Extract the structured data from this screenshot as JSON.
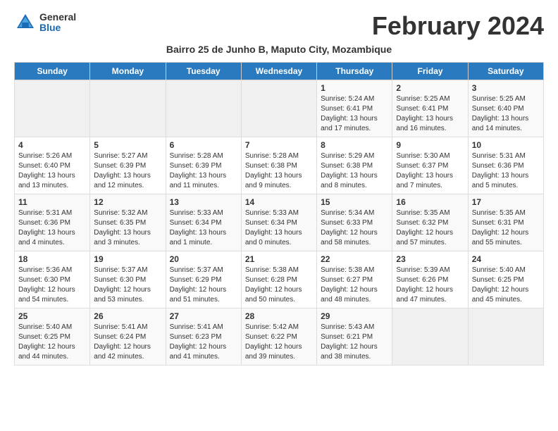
{
  "logo": {
    "general": "General",
    "blue": "Blue"
  },
  "title": "February 2024",
  "subtitle": "Bairro 25 de Junho B, Maputo City, Mozambique",
  "days_of_week": [
    "Sunday",
    "Monday",
    "Tuesday",
    "Wednesday",
    "Thursday",
    "Friday",
    "Saturday"
  ],
  "weeks": [
    [
      {
        "day": "",
        "info": ""
      },
      {
        "day": "",
        "info": ""
      },
      {
        "day": "",
        "info": ""
      },
      {
        "day": "",
        "info": ""
      },
      {
        "day": "1",
        "info": "Sunrise: 5:24 AM\nSunset: 6:41 PM\nDaylight: 13 hours\nand 17 minutes."
      },
      {
        "day": "2",
        "info": "Sunrise: 5:25 AM\nSunset: 6:41 PM\nDaylight: 13 hours\nand 16 minutes."
      },
      {
        "day": "3",
        "info": "Sunrise: 5:25 AM\nSunset: 6:40 PM\nDaylight: 13 hours\nand 14 minutes."
      }
    ],
    [
      {
        "day": "4",
        "info": "Sunrise: 5:26 AM\nSunset: 6:40 PM\nDaylight: 13 hours\nand 13 minutes."
      },
      {
        "day": "5",
        "info": "Sunrise: 5:27 AM\nSunset: 6:39 PM\nDaylight: 13 hours\nand 12 minutes."
      },
      {
        "day": "6",
        "info": "Sunrise: 5:28 AM\nSunset: 6:39 PM\nDaylight: 13 hours\nand 11 minutes."
      },
      {
        "day": "7",
        "info": "Sunrise: 5:28 AM\nSunset: 6:38 PM\nDaylight: 13 hours\nand 9 minutes."
      },
      {
        "day": "8",
        "info": "Sunrise: 5:29 AM\nSunset: 6:38 PM\nDaylight: 13 hours\nand 8 minutes."
      },
      {
        "day": "9",
        "info": "Sunrise: 5:30 AM\nSunset: 6:37 PM\nDaylight: 13 hours\nand 7 minutes."
      },
      {
        "day": "10",
        "info": "Sunrise: 5:31 AM\nSunset: 6:36 PM\nDaylight: 13 hours\nand 5 minutes."
      }
    ],
    [
      {
        "day": "11",
        "info": "Sunrise: 5:31 AM\nSunset: 6:36 PM\nDaylight: 13 hours\nand 4 minutes."
      },
      {
        "day": "12",
        "info": "Sunrise: 5:32 AM\nSunset: 6:35 PM\nDaylight: 13 hours\nand 3 minutes."
      },
      {
        "day": "13",
        "info": "Sunrise: 5:33 AM\nSunset: 6:34 PM\nDaylight: 13 hours\nand 1 minute."
      },
      {
        "day": "14",
        "info": "Sunrise: 5:33 AM\nSunset: 6:34 PM\nDaylight: 13 hours\nand 0 minutes."
      },
      {
        "day": "15",
        "info": "Sunrise: 5:34 AM\nSunset: 6:33 PM\nDaylight: 12 hours\nand 58 minutes."
      },
      {
        "day": "16",
        "info": "Sunrise: 5:35 AM\nSunset: 6:32 PM\nDaylight: 12 hours\nand 57 minutes."
      },
      {
        "day": "17",
        "info": "Sunrise: 5:35 AM\nSunset: 6:31 PM\nDaylight: 12 hours\nand 55 minutes."
      }
    ],
    [
      {
        "day": "18",
        "info": "Sunrise: 5:36 AM\nSunset: 6:30 PM\nDaylight: 12 hours\nand 54 minutes."
      },
      {
        "day": "19",
        "info": "Sunrise: 5:37 AM\nSunset: 6:30 PM\nDaylight: 12 hours\nand 53 minutes."
      },
      {
        "day": "20",
        "info": "Sunrise: 5:37 AM\nSunset: 6:29 PM\nDaylight: 12 hours\nand 51 minutes."
      },
      {
        "day": "21",
        "info": "Sunrise: 5:38 AM\nSunset: 6:28 PM\nDaylight: 12 hours\nand 50 minutes."
      },
      {
        "day": "22",
        "info": "Sunrise: 5:38 AM\nSunset: 6:27 PM\nDaylight: 12 hours\nand 48 minutes."
      },
      {
        "day": "23",
        "info": "Sunrise: 5:39 AM\nSunset: 6:26 PM\nDaylight: 12 hours\nand 47 minutes."
      },
      {
        "day": "24",
        "info": "Sunrise: 5:40 AM\nSunset: 6:25 PM\nDaylight: 12 hours\nand 45 minutes."
      }
    ],
    [
      {
        "day": "25",
        "info": "Sunrise: 5:40 AM\nSunset: 6:25 PM\nDaylight: 12 hours\nand 44 minutes."
      },
      {
        "day": "26",
        "info": "Sunrise: 5:41 AM\nSunset: 6:24 PM\nDaylight: 12 hours\nand 42 minutes."
      },
      {
        "day": "27",
        "info": "Sunrise: 5:41 AM\nSunset: 6:23 PM\nDaylight: 12 hours\nand 41 minutes."
      },
      {
        "day": "28",
        "info": "Sunrise: 5:42 AM\nSunset: 6:22 PM\nDaylight: 12 hours\nand 39 minutes."
      },
      {
        "day": "29",
        "info": "Sunrise: 5:43 AM\nSunset: 6:21 PM\nDaylight: 12 hours\nand 38 minutes."
      },
      {
        "day": "",
        "info": ""
      },
      {
        "day": "",
        "info": ""
      }
    ]
  ]
}
